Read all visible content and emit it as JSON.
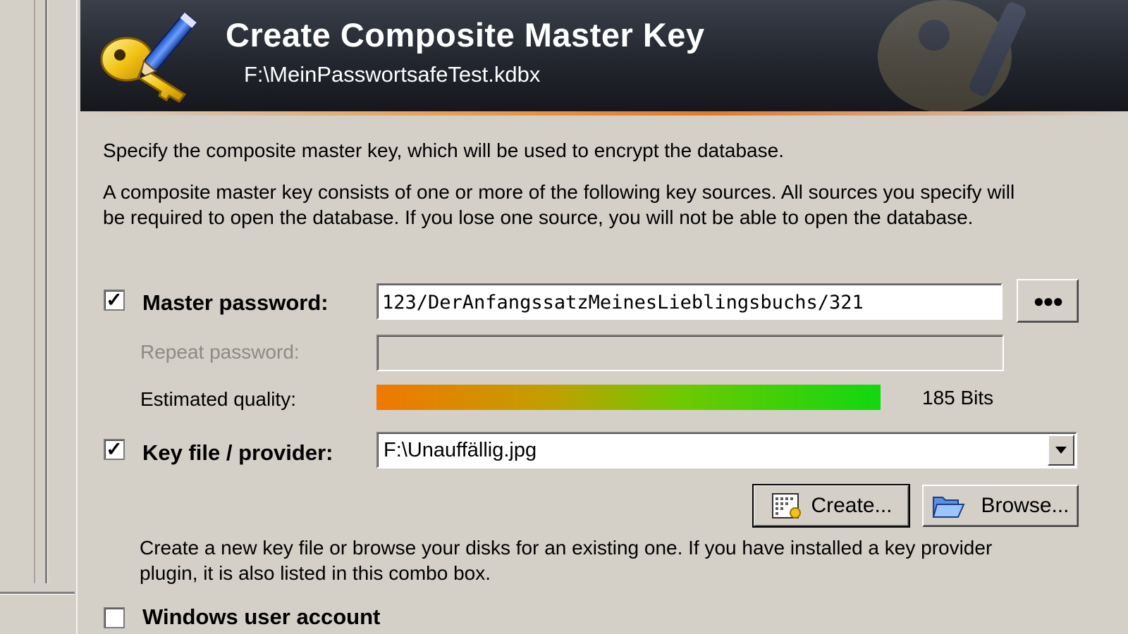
{
  "banner": {
    "title": "Create Composite Master Key",
    "subtitle": "F:\\MeinPasswortsafeTest.kdbx",
    "icon": "key-pencil-icon"
  },
  "intro": {
    "line1": "Specify the composite master key, which will be used to encrypt the database.",
    "line2": "A composite master key consists of one or more of the following key sources. All sources you specify will",
    "line3": "be required to open the database.  If you lose one source, you will not be able to open the database."
  },
  "master_password": {
    "checked": true,
    "label": "Master password:",
    "value": "123/DerAnfangssatzMeinesLieblingsbuchs/321",
    "toggle_label": "●●●"
  },
  "repeat_password": {
    "label": "Repeat password:",
    "value": ""
  },
  "quality": {
    "label": "Estimated quality:",
    "fraction": 0.98,
    "text": "185 Bits"
  },
  "key_file": {
    "checked": true,
    "label": "Key file / provider:",
    "value": "F:\\Unauffällig.jpg"
  },
  "buttons": {
    "create": "Create...",
    "browse": "Browse..."
  },
  "help": {
    "line1": "Create a new key file or browse your disks for an existing one. If you have installed a key provider",
    "line2": "plugin, it is also listed in this combo box."
  },
  "windows_account": {
    "checked": false,
    "label": "Windows user account"
  },
  "colors": {
    "quality_start": "#f07800",
    "quality_end": "#10d810",
    "banner_accent": "#e37a2a"
  }
}
